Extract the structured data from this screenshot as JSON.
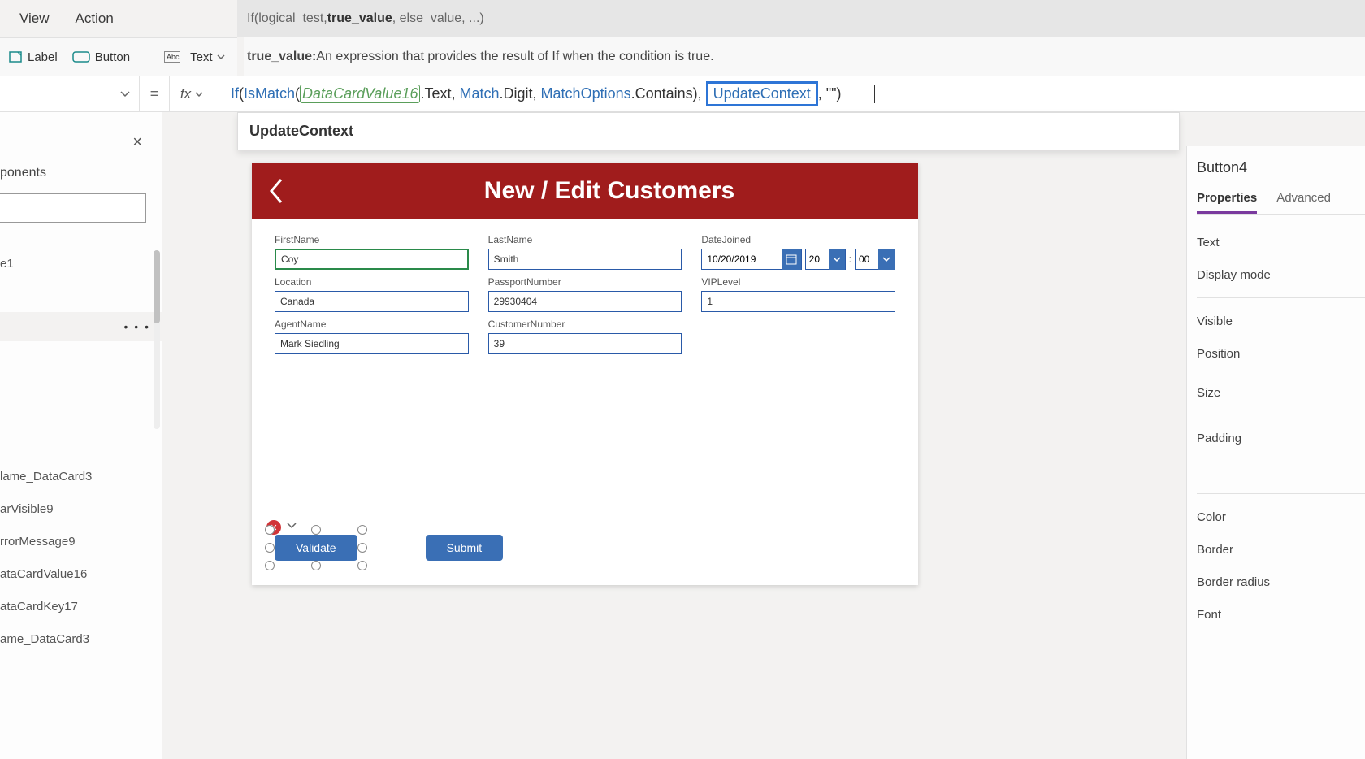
{
  "menu": {
    "view": "View",
    "action": "Action"
  },
  "hint": {
    "prefix": "If(logical_test, ",
    "bold": "true_value",
    "suffix": ", else_value, ...)"
  },
  "ribbon": {
    "label": "Label",
    "button": "Button",
    "text": "Text",
    "desc_bold": "true_value:",
    "desc_rest": " An expression that provides the result of If when the condition is true."
  },
  "formula": {
    "if": "If",
    "ismatch": "IsMatch",
    "ref": "DataCardValue16",
    "text": ".Text, ",
    "match": "Match",
    "digit": ".Digit, ",
    "matchoptions": "MatchOptions",
    "contains": ".Contains)",
    "comma_space": ", ",
    "update": "UpdateContext",
    "tail": ", \"\")"
  },
  "autocomplete": {
    "item": "UpdateContext"
  },
  "left": {
    "close": "×",
    "head": "ponents",
    "row_e1": "e1",
    "tree": {
      "a": "lame_DataCard3",
      "b": "arVisible9",
      "c": "rrorMessage9",
      "d": "ataCardValue16",
      "e": "ataCardKey17",
      "f": "ame_DataCard3"
    }
  },
  "canvas": {
    "title": "New / Edit Customers",
    "fields": {
      "firstname": {
        "label": "FirstName",
        "value": "Coy"
      },
      "lastname": {
        "label": "LastName",
        "value": "Smith"
      },
      "datejoined": {
        "label": "DateJoined",
        "value": "10/20/2019",
        "hh": "20",
        "mm": "00",
        "colon": ":"
      },
      "location": {
        "label": "Location",
        "value": "Canada"
      },
      "passport": {
        "label": "PassportNumber",
        "value": "29930404"
      },
      "vip": {
        "label": "VIPLevel",
        "value": "1"
      },
      "agent": {
        "label": "AgentName",
        "value": "Mark Siedling"
      },
      "custno": {
        "label": "CustomerNumber",
        "value": "39"
      }
    },
    "buttons": {
      "validate": "Validate",
      "submit": "Submit"
    }
  },
  "right": {
    "name": "Button4",
    "tabs": {
      "properties": "Properties",
      "advanced": "Advanced"
    },
    "rows": {
      "text": "Text",
      "display": "Display mode",
      "visible": "Visible",
      "position": "Position",
      "size": "Size",
      "padding": "Padding",
      "color": "Color",
      "border": "Border",
      "borderradius": "Border radius",
      "font": "Font"
    }
  }
}
